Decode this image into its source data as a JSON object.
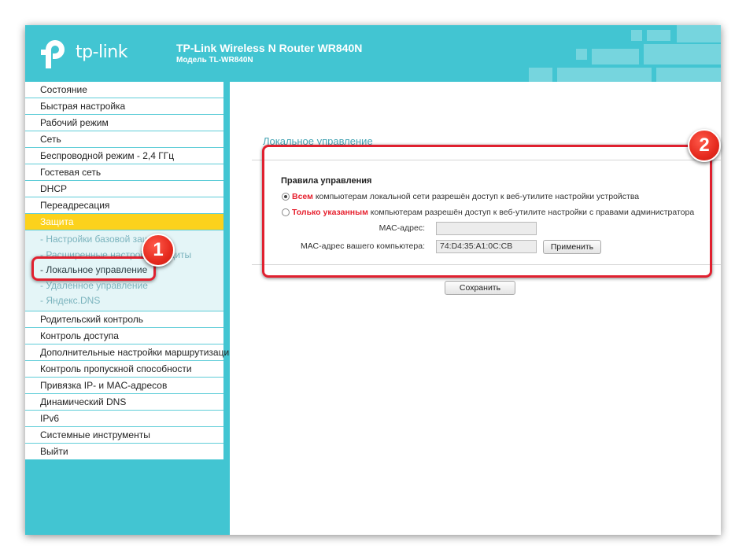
{
  "header": {
    "logo_text": "tp-link",
    "title": "TP-Link Wireless N Router WR840N",
    "model": "Модель TL-WR840N"
  },
  "sidebar": {
    "items_top": [
      "Состояние",
      "Быстрая настройка",
      "Рабочий режим",
      "Сеть",
      "Беспроводной режим - 2,4 ГГц",
      "Гостевая сеть",
      "DHCP",
      "Переадресация"
    ],
    "active_item": "Защита",
    "subitems": [
      "- Настройки базовой защиты",
      "- Расширенные настройки защиты",
      "- Локальное управление",
      "- Удаленное управление",
      "- Яндекс.DNS"
    ],
    "items_bottom": [
      "Родительский контроль",
      "Контроль доступа",
      "Дополнительные настройки маршрутизации",
      "Контроль пропускной способности",
      "Привязка IP- и MAC-адресов",
      "Динамический DNS",
      "IPv6",
      "Системные инструменты",
      "Выйти"
    ]
  },
  "main": {
    "page_title": "Локальное управление",
    "rules_heading": "Правила управления",
    "option_all_bold": "Всем",
    "option_all_text": " компьютерам локальной сети разрешён доступ к веб-утилите настройки устройства",
    "option_listed_bold": "Только указанным",
    "option_listed_text": " компьютерам разрешён доступ к веб-утилите настройки с правами администратора",
    "mac_label": "МАС-адрес:",
    "mac_value": "",
    "your_mac_label": "МАС-адрес вашего компьютера:",
    "your_mac_value": "74:D4:35:A1:0C:CB",
    "apply_button": "Применить",
    "save_button": "Сохранить"
  },
  "annotations": {
    "badge1": "1",
    "badge2": "2"
  },
  "colors": {
    "brand_teal": "#42c5d2",
    "active_yellow": "#fcd21c",
    "highlight_red": "#e0202f"
  }
}
